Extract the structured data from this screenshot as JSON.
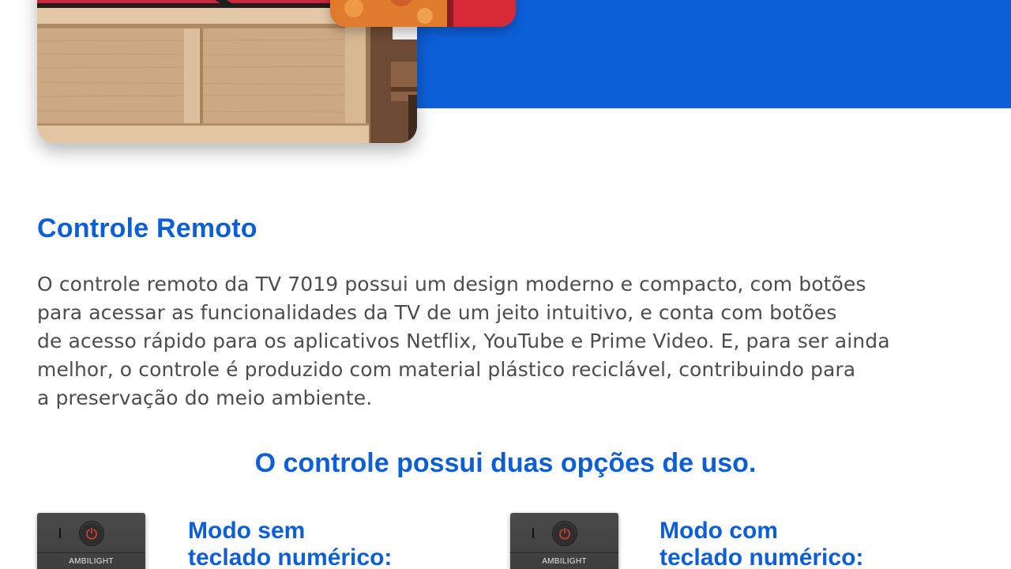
{
  "section": {
    "title": "Controle Remoto",
    "body_lines": [
      "O controle remoto da TV 7019 possui um design moderno e compacto, com botões",
      "para acessar as funcionalidades da TV de um jeito intuitivo, e conta com botões",
      "de acesso rápido para os aplicativos Netflix, YouTube e Prime Video. E, para ser ainda",
      "melhor, o controle é produzido com material plástico reciclável, contribuindo para",
      "a preservação do meio ambiente."
    ]
  },
  "subheading": "O controle possui duas opções de uso.",
  "modes": [
    {
      "label_lines": [
        "Modo sem",
        "teclado numérico:"
      ],
      "remote_text": "AMBILIGHT"
    },
    {
      "label_lines": [
        "Modo com",
        "teclado numérico:"
      ],
      "remote_text": "AMBILIGHT"
    }
  ],
  "colors": {
    "brand_blue": "#0d5fd8",
    "body_text": "#4d4d4d",
    "power_red": "#d8442b"
  },
  "icons": {
    "power": "power-icon"
  }
}
